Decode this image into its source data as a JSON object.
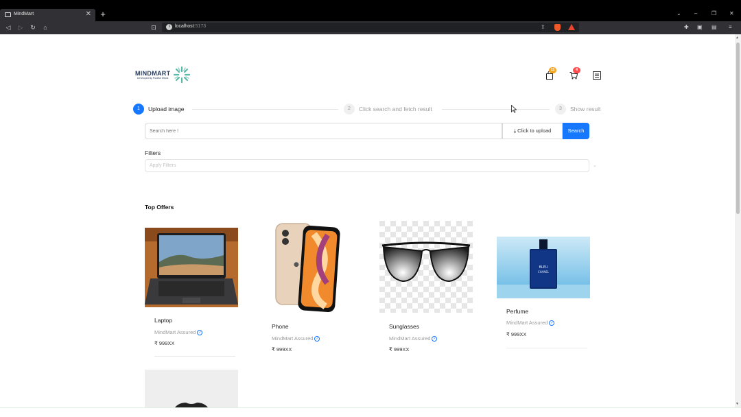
{
  "browser": {
    "tab_title": "MindMart",
    "tab_close": "✕",
    "new_tab": "+",
    "url_host": "localhost",
    "url_port": ":5173",
    "nav": {
      "back": "◁",
      "forward": "▷",
      "reload": "↻",
      "home": "⌂",
      "bookmark": "⊡"
    },
    "window_controls": {
      "dropdown": "⌄",
      "minimize": "–",
      "restore": "❐",
      "close": "✕"
    }
  },
  "header": {
    "brand": "MINDMART",
    "tagline": "Developed By Positive Minds",
    "brand_color": "#233a5e",
    "accent_color": "#5ab8a8",
    "orders_badge": "11",
    "cart_badge": "4",
    "orders_badge_color": "#f5a623",
    "cart_badge_color": "#ff4d4f"
  },
  "steps": [
    {
      "num": "1",
      "label": "Upload image",
      "state": "active"
    },
    {
      "num": "2",
      "label": "Click search and fetch result",
      "state": "wait"
    },
    {
      "num": "3",
      "label": "Show result",
      "state": "wait"
    }
  ],
  "search": {
    "placeholder": "Search here !",
    "upload_label": "Click to upload",
    "search_label": "Search",
    "primary_color": "#1677ff"
  },
  "filters": {
    "label": "Filters",
    "placeholder": "Apply Filters"
  },
  "top_offers": {
    "title": "Top Offers",
    "products": [
      {
        "name": "Laptop",
        "assured": "MindMart Assured",
        "price": "₹ 999XX",
        "image": "laptop"
      },
      {
        "name": "Phone",
        "assured": "MindMart Assured",
        "price": "₹ 999XX",
        "image": "phone"
      },
      {
        "name": "Sunglasses",
        "assured": "MindMart Assured",
        "price": "₹ 999XX",
        "image": "sunglasses"
      },
      {
        "name": "Perfume",
        "assured": "MindMart Assured",
        "price": "₹ 999XX",
        "image": "perfume"
      },
      {
        "name": "",
        "assured": "",
        "price": "",
        "image": "tshirt"
      }
    ]
  }
}
